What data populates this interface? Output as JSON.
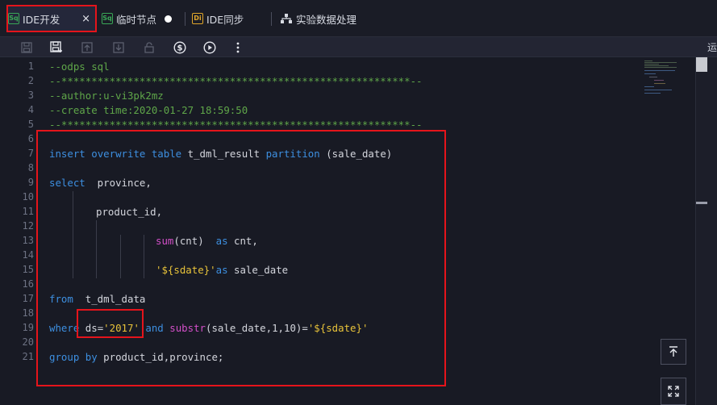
{
  "tabs": [
    {
      "badge": "Sq",
      "label": "IDE开发",
      "close": "×",
      "active": true
    },
    {
      "badge": "Sq",
      "label": "临时节点",
      "unsaved": true
    },
    {
      "badge": "Di",
      "label": "IDE同步"
    },
    {
      "label": "实验数据处理"
    }
  ],
  "toolbar": {
    "buttons": [
      "save-icon",
      "save-as-icon",
      "submit-icon",
      "download-icon",
      "lock-icon",
      "cost-icon",
      "run-icon",
      "more-icon"
    ],
    "run_label": "运"
  },
  "editor": {
    "line_numbers": [
      "1",
      "2",
      "3",
      "4",
      "5",
      "6",
      "7",
      "8",
      "9",
      "10",
      "11",
      "12",
      "13",
      "14",
      "15",
      "16",
      "17",
      "18",
      "19",
      "20",
      "21"
    ],
    "lines": {
      "l1": "--odps sql",
      "l2": "--**********************************************************--",
      "l3": "--author:u-vi3pk2mz",
      "l4": "--create time:2020-01-27 18:59:50",
      "l5": "--**********************************************************--",
      "l7": {
        "insert": "insert",
        "overwrite": "overwrite",
        "table": "table",
        "text1": " t_dml_result ",
        "partition": "partition",
        "text2": " (sale_date)"
      },
      "l9": {
        "select": "select",
        "text": "  province,"
      },
      "l11": {
        "text": "product_id,"
      },
      "l13": {
        "fn": "sum",
        "text1": "(cnt)  ",
        "as": "as",
        "text2": " cnt,"
      },
      "l15": {
        "str": "'${sdate}'",
        "as": "as",
        "text": " sale_date"
      },
      "l17": {
        "from": "from",
        "text": "  t_dml_data"
      },
      "l19": {
        "where": "where",
        "text1": " ds=",
        "str1": "'2017'",
        "and": "and",
        "fn": "substr",
        "text2": "(sale_date,1,10)=",
        "str2": "'${sdate}'"
      },
      "l21": {
        "group": "group",
        "by": "by",
        "text": " product_id,province;"
      }
    }
  },
  "colors": {
    "highlight_red": "#e5141b",
    "keyword_blue": "#3d8fe0",
    "comment_green": "#5fa649",
    "function_magenta": "#d24fc8",
    "string_yellow": "#e8c33a"
  }
}
